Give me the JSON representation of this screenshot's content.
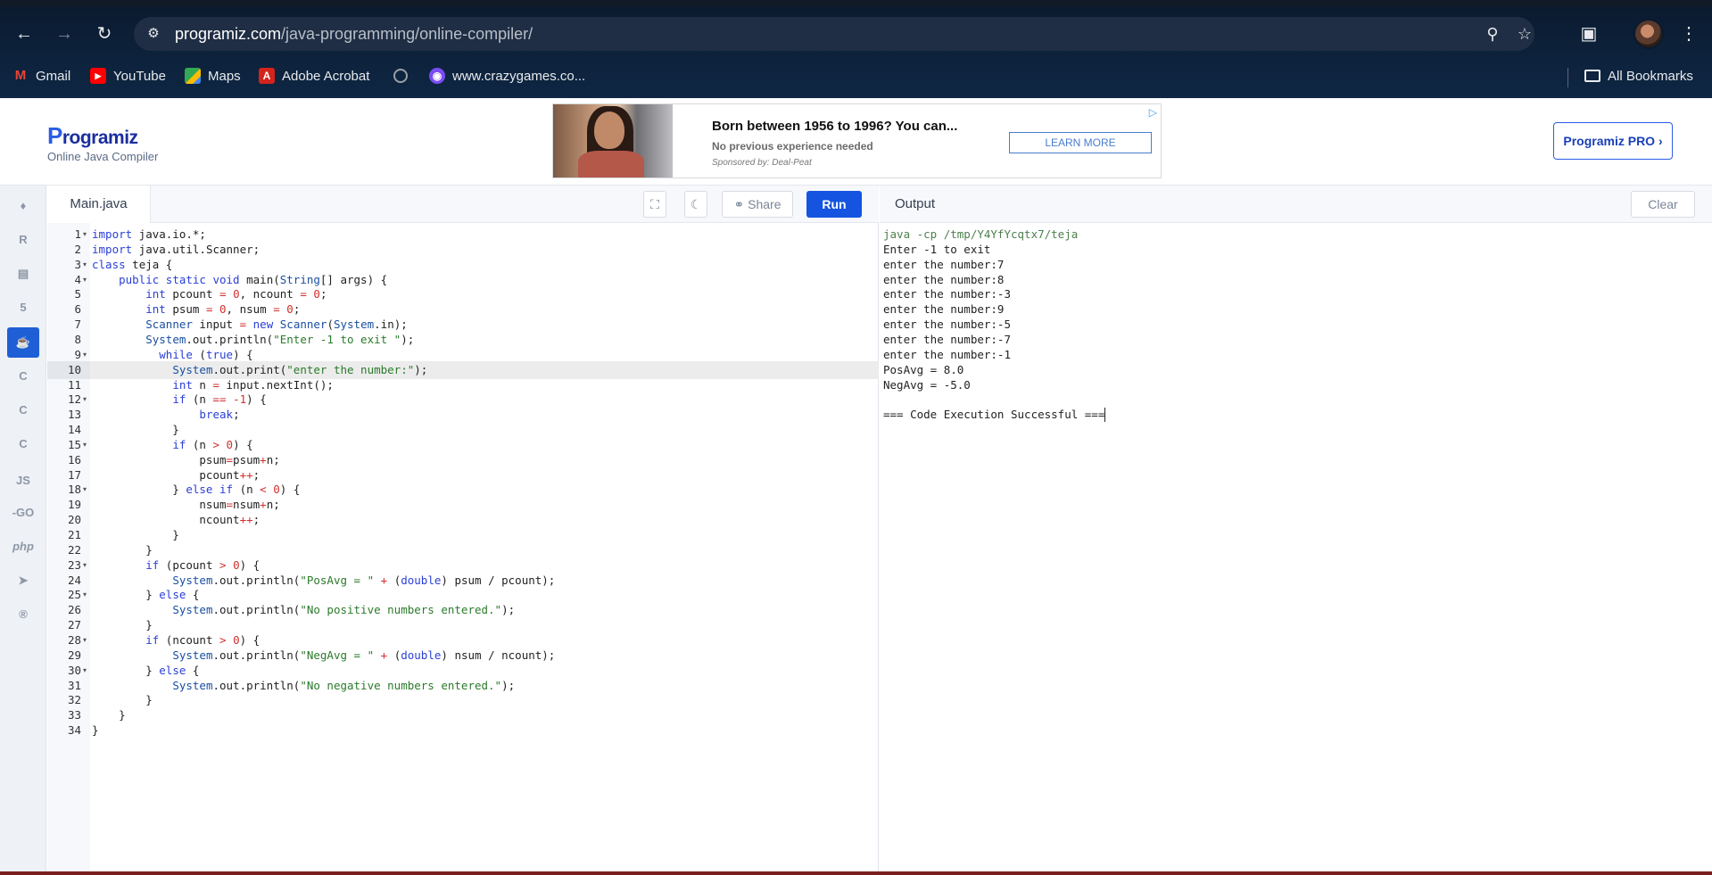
{
  "browser": {
    "url_host": "programiz.com",
    "url_path": "/java-programming/online-compiler/",
    "bookmarks": [
      {
        "label": "Gmail",
        "icon": "gmail-icon",
        "color": "#ea4335"
      },
      {
        "label": "YouTube",
        "icon": "youtube-icon",
        "color": "#ff0000"
      },
      {
        "label": "Maps",
        "icon": "maps-icon",
        "color": "#34a853"
      },
      {
        "label": "Adobe Acrobat",
        "icon": "acrobat-icon",
        "color": "#d4241c"
      },
      {
        "label": "",
        "icon": "globe-icon",
        "color": "#9aa0a6"
      },
      {
        "label": "www.crazygames.co...",
        "icon": "crazygames-icon",
        "color": "#7a4cf2"
      }
    ],
    "all_bookmarks": "All Bookmarks"
  },
  "header": {
    "logo": "rogramiz",
    "logo_initial": "P",
    "subtitle": "Online Java Compiler",
    "pro_button": "Programiz PRO ›"
  },
  "ad": {
    "title": "Born between 1956 to 1996? You can...",
    "subtitle": "No previous experience needed",
    "sponsor": "Sponsored by: Deal-Peat",
    "button": "LEARN MORE"
  },
  "rail": {
    "items": [
      "python",
      "r",
      "sql",
      "html",
      "java",
      "c",
      "cpp",
      "csharp",
      "JS",
      "GO",
      "php",
      "swift",
      "rust"
    ],
    "labels": {
      "js": "JS",
      "go": "-GO",
      "php": "php"
    },
    "active": "java"
  },
  "editor": {
    "file_name": "Main.java",
    "share_label": "Share",
    "run_label": "Run",
    "active_line": 10,
    "lines": [
      "import java.io.*;",
      "import java.util.Scanner;",
      "class teja {",
      "    public static void main(String[] args) {",
      "        int pcount = 0, ncount = 0;",
      "        int psum = 0, nsum = 0;",
      "        Scanner input = new Scanner(System.in);",
      "        System.out.println(\"Enter -1 to exit \");",
      "          while (true) {",
      "            System.out.print(\"enter the number:\");",
      "            int n = input.nextInt();",
      "            if (n == -1) {",
      "                break;",
      "            }",
      "            if (n > 0) {",
      "                psum=psum+n;",
      "                pcount++;",
      "            } else if (n < 0) {",
      "                nsum=nsum+n;",
      "                ncount++;",
      "            }",
      "        }",
      "        if (pcount > 0) {",
      "            System.out.println(\"PosAvg = \" + (double) psum / pcount);",
      "        } else {",
      "            System.out.println(\"No positive numbers entered.\");",
      "        }",
      "        if (ncount > 0) {",
      "            System.out.println(\"NegAvg = \" + (double) nsum / ncount);",
      "        } else {",
      "            System.out.println(\"No negative numbers entered.\");",
      "        }",
      "    }",
      "}"
    ],
    "foldable_lines": [
      1,
      3,
      4,
      9,
      12,
      15,
      18,
      23,
      25,
      28,
      30
    ]
  },
  "output": {
    "title": "Output",
    "clear_label": "Clear",
    "command": "java -cp /tmp/Y4YfYcqtx7/teja",
    "lines": [
      "Enter -1 to exit",
      "enter the number:7",
      "enter the number:8",
      "enter the number:-3",
      "enter the number:9",
      "enter the number:-5",
      "enter the number:-7",
      "enter the number:-1",
      "PosAvg = 8.0",
      "NegAvg = -5.0",
      "",
      "=== Code Execution Successful ==="
    ]
  }
}
